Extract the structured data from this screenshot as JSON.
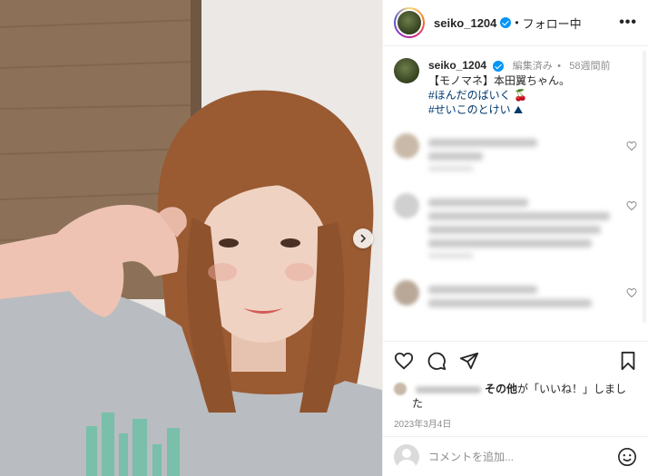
{
  "post": {
    "username": "seiko_1204",
    "follow_status": "フォロー中",
    "more_label": "•••",
    "caption": {
      "username": "seiko_1204",
      "edited": "編集済み",
      "age": "58週間前",
      "text": "【モノマネ】本田翼ちゃん。",
      "hashtag1": "#ほんだのばいく",
      "hashtag1_emoji": "🍒",
      "hashtag2": "#せいこのとけい",
      "hashtag2_emoji": "⛰"
    },
    "likes": {
      "text_prefix": "その他",
      "text_suffix": "が「いいね！」しました"
    },
    "date": "2023年3月4日",
    "comment_placeholder": "コメントを追加..."
  },
  "icons": {
    "verified": "verified-badge-icon",
    "next": "chevron-right-icon",
    "heart": "heart-icon",
    "comment": "comment-icon",
    "share": "send-icon",
    "bookmark": "bookmark-icon",
    "emoji": "smiley-icon"
  },
  "colors": {
    "link": "#00376b",
    "verified": "#0095f6",
    "muted": "#8e8e8e"
  }
}
